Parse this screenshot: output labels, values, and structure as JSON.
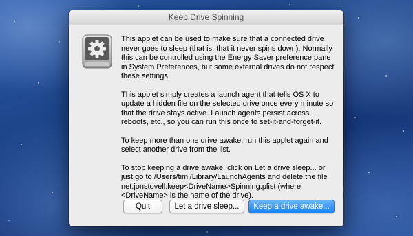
{
  "window": {
    "title": "Keep Drive Spinning"
  },
  "icons": {
    "app_icon": "external-drive-gear-icon"
  },
  "body": {
    "paragraphs": [
      "This applet can be used to make sure that a connected drive never goes to sleep (that is, that it never spins down). Normally this can be controlled using the Energy Saver preference pane in System Preferences, but some external drives do not respect these settings.",
      "This applet simply creates a launch agent that tells OS X to update a hidden file on the selected drive once every minute so that the drive stays active. Launch agents persist across reboots, etc., so you can run this once to set-it-and-forget-it.",
      "To keep more than one drive awake, run this applet again and select another drive from the list.",
      "To stop keeping a drive awake, click on Let a drive sleep... or just go to /Users/timl/Library/LaunchAgents and delete the file net.jonstovell.keep<DriveName>Spinning.plist (where <DriveName> is the name of the drive)."
    ]
  },
  "buttons": {
    "quit": "Quit",
    "sleep": "Let a drive sleep...",
    "awake": "Keep a drive awake..."
  },
  "colors": {
    "default_button": "#1a82fb",
    "window_background": "#ececec",
    "desktop": "#1d4589"
  }
}
